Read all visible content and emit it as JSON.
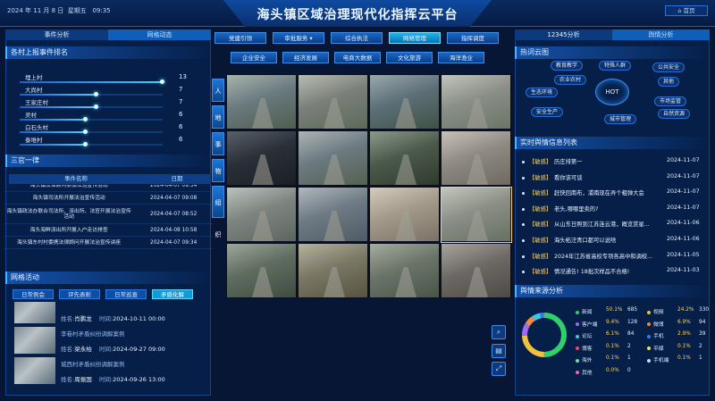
{
  "header": {
    "title": "海头镇区域治理现代化指挥云平台",
    "date": "2024 年 11 月 8 日",
    "weekday": "星期五",
    "time": "09:35",
    "home_label": "首页"
  },
  "left": {
    "tabs": [
      "事件分析",
      "网格动态"
    ],
    "ranking": {
      "title": "各村上报事件排名",
      "items": [
        {
          "name": "埋上村",
          "value": 13
        },
        {
          "name": "大尚村",
          "value": 7
        },
        {
          "name": "王家庄村",
          "value": 7
        },
        {
          "name": "灵村",
          "value": 6
        },
        {
          "name": "白石头村",
          "value": 6
        },
        {
          "name": "泰堆村",
          "value": 6
        }
      ]
    },
    "sanguan": {
      "title": "三官一律",
      "columns": [
        "事件名称",
        "日期"
      ],
      "rows": [
        {
          "name": "海头镇法律顾问参加法治宣传活动",
          "date": "2024-04-07 09:34"
        },
        {
          "name": "海头镇司法所开展法治宣传活动",
          "date": "2024-04-07 09:08"
        },
        {
          "name": "海头镇政法办联合司法所、派出所、法官开展法治宣传活动",
          "date": "2024-04-07 08:52"
        },
        {
          "name": "海头海鲜派出所开展入户走访排查",
          "date": "2024-04-08 10:58"
        },
        {
          "name": "海头镇东村村委携法律顾问开展法治宣传讲座",
          "date": "2024-04-07 09:34"
        }
      ]
    },
    "grid_activity": {
      "title": "网格活动",
      "buttons": [
        "日常例会",
        "评先表彰",
        "日常巡查",
        "矛盾化解"
      ],
      "active_button": "矛盾化解",
      "items": [
        {
          "title": "",
          "name_label": "姓名:",
          "name": "肖鹏龙",
          "time_label": "时间:",
          "time": "2024-10-11 00:00"
        },
        {
          "title": "李巷村矛盾纠纷调解案例",
          "name_label": "姓名:",
          "name": "梁永柏",
          "time_label": "时间:",
          "time": "2024-09-27 09:00"
        },
        {
          "title": "城西村矛盾纠纷调解案例",
          "name_label": "姓名:",
          "name": "周振国",
          "time_label": "时间:",
          "time": "2024-09-26 13:00"
        }
      ]
    }
  },
  "center": {
    "nav_row1": [
      "党建引领",
      "审批服务",
      "综合执法",
      "网格管理",
      "指挥调度"
    ],
    "nav_row2": [
      "企业安全",
      "经济发展",
      "电商大数据",
      "文化旅游",
      "海洋渔业"
    ],
    "nav_active": "网格管理",
    "side_tabs": [
      "人",
      "地",
      "事",
      "物",
      "组织"
    ],
    "camera_count": 16
  },
  "right": {
    "tabs": [
      "12345分析",
      "舆情分析"
    ],
    "hot_cloud": {
      "title": "热词云图",
      "center_label": "HOT",
      "tags": [
        "教育教学",
        "特殊人群",
        "公共安全",
        "农业农村",
        "其他",
        "生态环境",
        "市场监管",
        "安全生产",
        "城市管理",
        "自然资源"
      ]
    },
    "news": {
      "title": "实时舆情信息列表",
      "items": [
        {
          "tag": "【敏感】",
          "text": "历庄排第一",
          "date": "2024-11-07"
        },
        {
          "tag": "【敏感】",
          "text": "看你该可谈",
          "date": "2024-11-07"
        },
        {
          "tag": "【敏感】",
          "text": "赶快回南布，浦南现在弄个粗弹大会",
          "date": "2024-11-07"
        },
        {
          "tag": "【敏感】",
          "text": "老头,哪哪里卖的?",
          "date": "2024-11-07"
        },
        {
          "tag": "【敏感】",
          "text": "从山东日照到江苏连云港，概览赏星...",
          "date": "2024-11-06"
        },
        {
          "tag": "【敏感】",
          "text": "海头柘汪青口都可以说啥",
          "date": "2024-11-06"
        },
        {
          "tag": "【敏感】",
          "text": "2024年江苏省高校专项各高中和调校...",
          "date": "2024-11-05"
        },
        {
          "tag": "【敏感】",
          "text": "情况通告! 18批次样品不合格!",
          "date": "2024-11-03"
        }
      ]
    },
    "source": {
      "title": "舆情来源分析",
      "items": [
        {
          "name": "新闻",
          "pct": "50.1%",
          "count": "685",
          "color": "#2fd06b"
        },
        {
          "name": "视频",
          "pct": "24.2%",
          "count": "330",
          "color": "#f0c23c"
        },
        {
          "name": "客户端",
          "pct": "9.4%",
          "count": "128",
          "color": "#9d6cf0"
        },
        {
          "name": "微博",
          "pct": "6.9%",
          "count": "94",
          "color": "#f08a3c"
        },
        {
          "name": "论坛",
          "pct": "6.1%",
          "count": "84",
          "color": "#3ec8e8"
        },
        {
          "name": "手机",
          "pct": "2.9%",
          "count": "39",
          "color": "#2f7cf0"
        },
        {
          "name": "博客",
          "pct": "0.1%",
          "count": "2",
          "color": "#e84a6a"
        },
        {
          "name": "平媒",
          "pct": "0.1%",
          "count": "2",
          "color": "#f3e060"
        },
        {
          "name": "海外",
          "pct": "0.1%",
          "count": "1",
          "color": "#6ee0a0"
        },
        {
          "name": "手机端",
          "pct": "0.1%",
          "count": "1",
          "color": "#cfd8e8"
        },
        {
          "name": "其他",
          "pct": "0.0%",
          "count": "0",
          "color": "#e86ab0"
        }
      ],
      "tool_icons": [
        "search-icon",
        "chart-icon",
        "expand-icon"
      ]
    }
  }
}
